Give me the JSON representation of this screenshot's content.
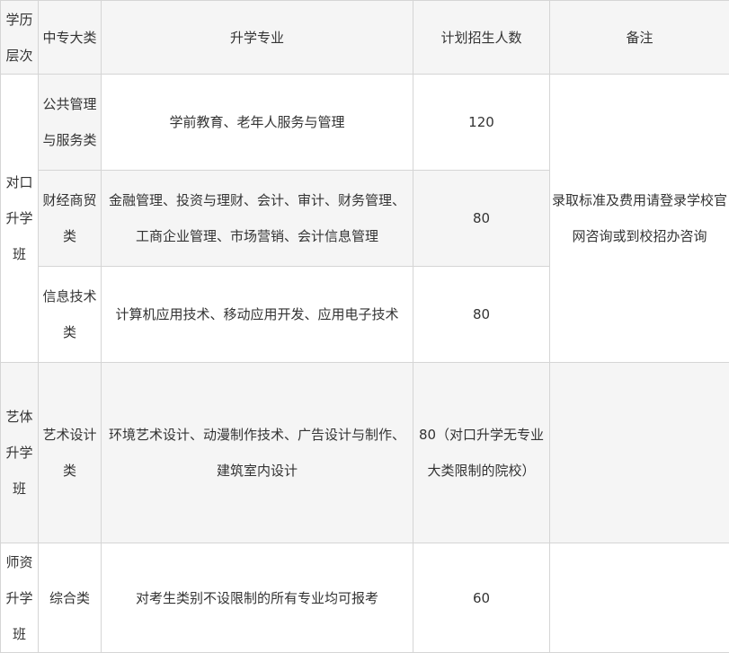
{
  "headers": {
    "level": "学历层次",
    "category": "中专大类",
    "major": "升学专业",
    "quota": "计划招生人数",
    "note": "备注"
  },
  "groups": {
    "duikou": "对口升学班",
    "yiti": "艺体升学班",
    "shizi": "师资升学班"
  },
  "rows": [
    {
      "category": "公共管理与服务类",
      "major": "学前教育、老年人服务与管理",
      "quota": "120"
    },
    {
      "category": "财经商贸类",
      "major": "金融管理、投资与理财、会计、审计、财务管理、工商企业管理、市场营销、会计信息管理",
      "quota": "80"
    },
    {
      "category": "信息技术类",
      "major": "计算机应用技术、移动应用开发、应用电子技术",
      "quota": "80"
    },
    {
      "category": "艺术设计类",
      "major": "环境艺术设计、动漫制作技术、广告设计与制作、建筑室内设计",
      "quota": "80（对口升学无专业大类限制的院校）"
    },
    {
      "category": "综合类",
      "major": "对考生类别不设限制的所有专业均可报考",
      "quota": "60"
    }
  ],
  "notes": {
    "duikou": "录取标准及费用请登录学校官网咨询或到校招办咨询",
    "yiti": "",
    "shizi": ""
  }
}
